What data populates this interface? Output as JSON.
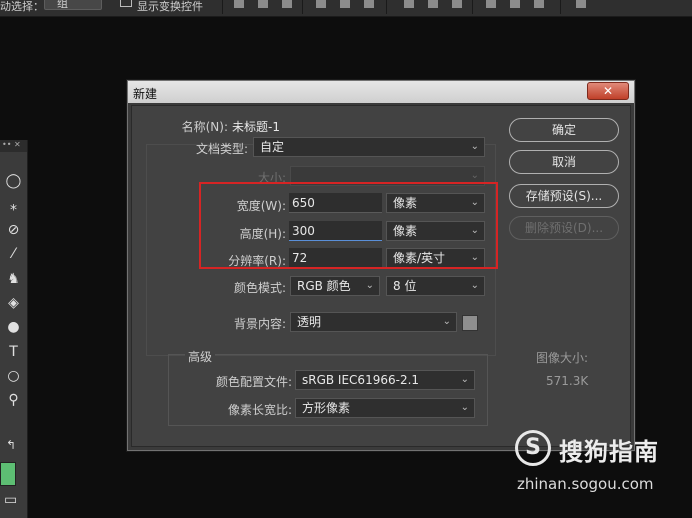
{
  "options_bar": {
    "auto_select_label": "动选择：",
    "auto_select_value": "组",
    "transform_label": "显示变换控件"
  },
  "tool_panel": {
    "header_glyphs": "•• ✕",
    "tools": [
      {
        "name": "elliptical-marquee",
        "glyph": "◯"
      },
      {
        "name": "magic-wand",
        "glyph": "⁎"
      },
      {
        "name": "eyedropper",
        "glyph": "⊘"
      },
      {
        "name": "brush",
        "glyph": "⁄"
      },
      {
        "name": "clone-stamp",
        "glyph": "♞"
      },
      {
        "name": "paint-bucket",
        "glyph": "◈"
      },
      {
        "name": "burn",
        "glyph": "●"
      },
      {
        "name": "type",
        "glyph": "T"
      },
      {
        "name": "ellipse",
        "glyph": "○"
      },
      {
        "name": "zoom",
        "glyph": "⚲"
      }
    ],
    "swap_glyph": "↰",
    "screen_mode_glyph": "▭",
    "foreground_color": "#5dbe73"
  },
  "dialog": {
    "title": "新建",
    "close_glyph": "✕",
    "name_label": "名称(N):",
    "name_value": "未标题-1",
    "doc_type_label": "文档类型:",
    "doc_type_value": "自定",
    "size_label": "大小:",
    "size_value": "",
    "width_label": "宽度(W):",
    "width_value": "650",
    "width_unit": "像素",
    "height_label": "高度(H):",
    "height_value": "300",
    "height_unit": "像素",
    "resolution_label": "分辨率(R):",
    "resolution_value": "72",
    "resolution_unit": "像素/英寸",
    "color_mode_label": "颜色模式:",
    "color_mode_value": "RGB 颜色",
    "bit_depth_value": "8 位",
    "background_label": "背景内容:",
    "background_value": "透明",
    "advanced_label": "高级",
    "color_profile_label": "颜色配置文件:",
    "color_profile_value": "sRGB IEC61966-2.1",
    "pixel_aspect_label": "像素长宽比:",
    "pixel_aspect_value": "方形像素",
    "buttons": {
      "ok": "确定",
      "cancel": "取消",
      "save_preset": "存储预设(S)...",
      "delete_preset": "删除预设(D)..."
    },
    "image_size_label": "图像大小:",
    "image_size_value": "571.3K",
    "highlight_color": "#d62424"
  },
  "watermark": {
    "logo_glyph": "S",
    "name": "搜狗指南",
    "url": "zhinan.sogou.com"
  },
  "chevron_glyph": "⌄"
}
